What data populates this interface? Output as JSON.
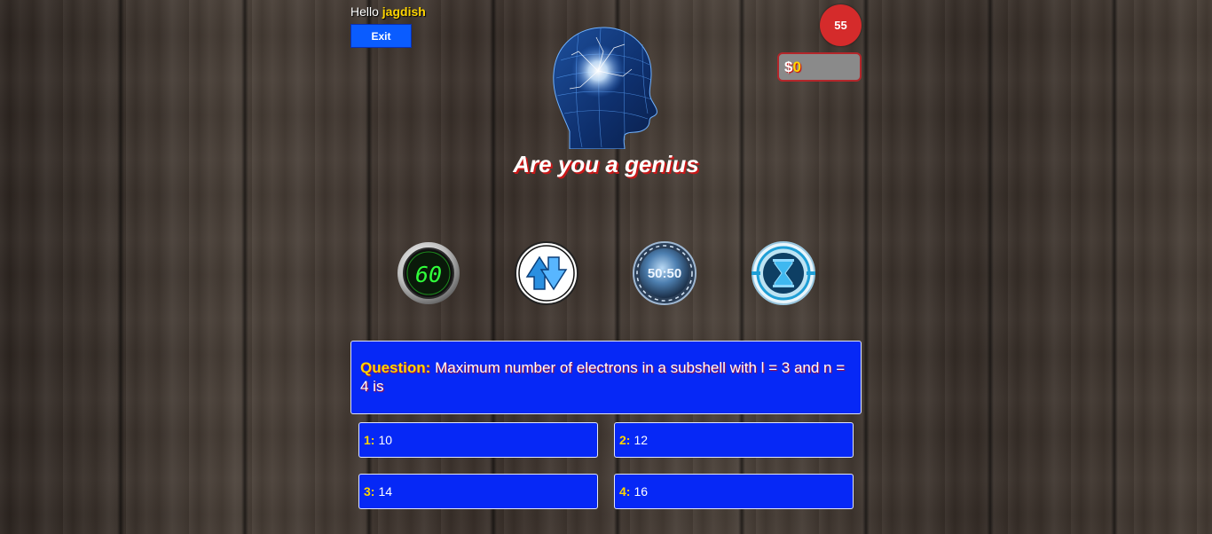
{
  "header": {
    "greeting": "Hello",
    "username": "jagdish",
    "exit_label": "Exit"
  },
  "status": {
    "timer": "55",
    "currency": "$",
    "money": "0"
  },
  "title": "Are you a genius",
  "lifelines": [
    {
      "icon": "timer-60-icon",
      "label": "60"
    },
    {
      "icon": "swap-question-icon"
    },
    {
      "icon": "fifty-fifty-icon",
      "label": "50:50"
    },
    {
      "icon": "hourglass-icon"
    }
  ],
  "question": {
    "label": "Question:",
    "text": "Maximum number of electrons in a subshell with l = 3 and n = 4 is"
  },
  "answers": [
    {
      "num": "1:",
      "text": "10"
    },
    {
      "num": "2:",
      "text": "12"
    },
    {
      "num": "3:",
      "text": "14"
    },
    {
      "num": "4:",
      "text": "16"
    }
  ],
  "colors": {
    "answer_bg": "#0628f6",
    "accent_yellow": "#ffd500",
    "timer_red": "#d52b2b",
    "exit_blue": "#0a5cff"
  }
}
